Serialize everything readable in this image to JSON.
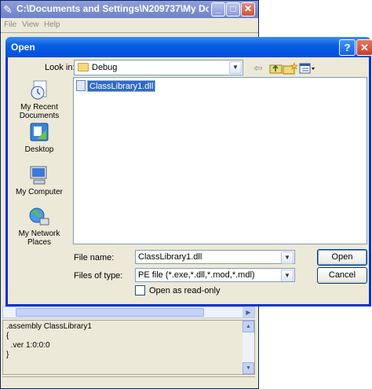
{
  "background_window": {
    "title": "C:\\Documents and Settings\\N209737\\My Docu...",
    "menu": [
      "File",
      "View",
      "Help"
    ],
    "code_lines": [
      ".assembly ClassLibrary1",
      "{",
      "  .ver 1:0:0:0",
      "}"
    ]
  },
  "dialog": {
    "title": "Open",
    "look_in_label": "Look in:",
    "look_in_value": "Debug",
    "places": [
      {
        "label": "My Recent Documents",
        "icon": "recent-documents-icon"
      },
      {
        "label": "Desktop",
        "icon": "desktop-icon"
      },
      {
        "label": "My Computer",
        "icon": "my-computer-icon"
      },
      {
        "label": "My Network Places",
        "icon": "network-places-icon"
      }
    ],
    "files": [
      {
        "name": "ClassLibrary1.dll",
        "selected": true
      }
    ],
    "file_name_label": "File name:",
    "file_name_value": "ClassLibrary1.dll",
    "files_of_type_label": "Files of type:",
    "files_of_type_value": "PE file (*.exe,*.dll,*.mod,*.mdl)",
    "read_only_label": "Open as read-only",
    "open_button": "Open",
    "cancel_button": "Cancel"
  },
  "colors": {
    "dialog_title": "#0054e3",
    "selection": "#316ac5",
    "window_face": "#ece9d8"
  }
}
